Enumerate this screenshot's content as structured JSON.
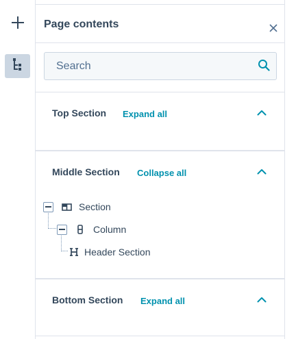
{
  "rail": {
    "add_icon": "plus-icon",
    "tree_icon": "tree-structure-icon"
  },
  "panel": {
    "title": "Page contents",
    "close_icon": "close-icon"
  },
  "search": {
    "placeholder": "Search",
    "value": "",
    "icon": "search-icon"
  },
  "sections": [
    {
      "title": "Top Section",
      "action": "Expand all",
      "chevron": "chevron-up-icon"
    },
    {
      "title": "Middle Section",
      "action": "Collapse all",
      "chevron": "chevron-up-icon"
    },
    {
      "title": "Bottom Section",
      "action": "Expand all",
      "chevron": "chevron-up-icon"
    }
  ],
  "tree": [
    {
      "label": "Section",
      "icon": "section-layout-icon",
      "expanded": true
    },
    {
      "label": "Column",
      "icon": "column-icon",
      "expanded": true
    },
    {
      "label": "Header Section",
      "icon": "heading-icon"
    }
  ],
  "colors": {
    "text": "#33475b",
    "link": "#0091ae",
    "border": "#dfe3eb",
    "active_rail": "#cbd6e2"
  }
}
